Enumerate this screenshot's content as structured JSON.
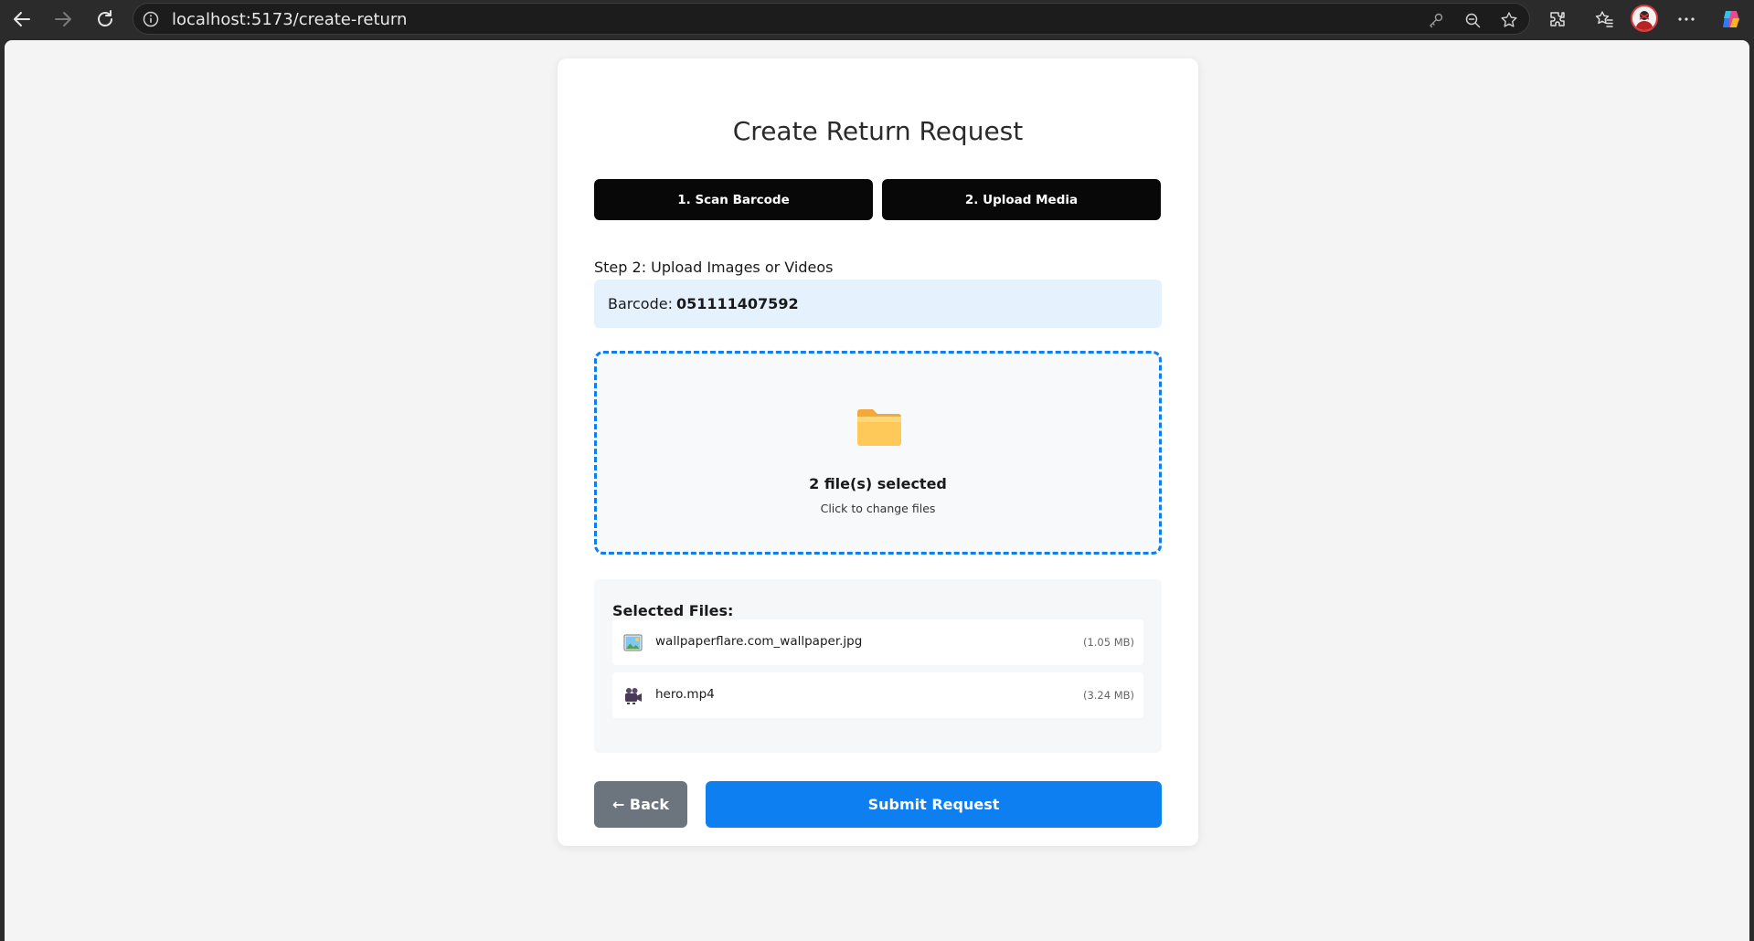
{
  "browser": {
    "url": "localhost:5173/create-return"
  },
  "page": {
    "title": "Create Return Request",
    "steps": [
      {
        "label": "1. Scan Barcode"
      },
      {
        "label": "2. Upload Media"
      }
    ],
    "step_heading": "Step 2: Upload Images or Videos",
    "barcode": {
      "label": "Barcode:",
      "value": "051111407592"
    },
    "dropzone": {
      "icon": "folder-icon",
      "main_text": "2 file(s) selected",
      "sub_text": "Click to change files"
    },
    "selected_files": {
      "title": "Selected Files:",
      "files": [
        {
          "icon": "image-file-icon",
          "name": "wallpaperflare.com_wallpaper.jpg",
          "size": "(1.05 MB)"
        },
        {
          "icon": "video-file-icon",
          "name": "hero.mp4",
          "size": "(3.24 MB)"
        }
      ]
    },
    "actions": {
      "back_label": "← Back",
      "submit_label": "Submit Request"
    }
  },
  "colors": {
    "primary": "#0d7ff0",
    "step_button_bg": "#080808",
    "back_button_bg": "#6c757d",
    "barcode_bg": "#e5f1fd",
    "page_bg": "#f4f4f4"
  }
}
